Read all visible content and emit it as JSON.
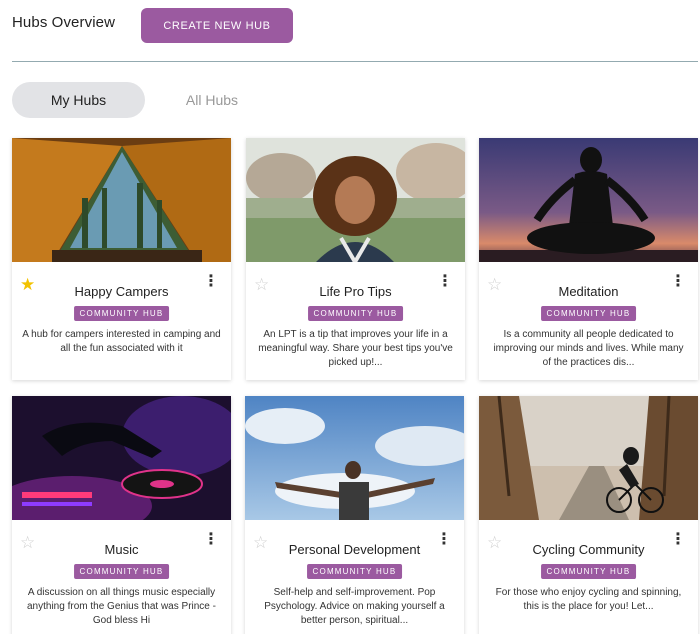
{
  "header": {
    "title": "Hubs Overview",
    "create_button": "CREATE NEW HUB"
  },
  "tabs": [
    {
      "label": "My Hubs",
      "active": true
    },
    {
      "label": "All Hubs",
      "active": false
    }
  ],
  "colors": {
    "accent": "#9b5aa0",
    "tab_active_bg": "#e2e3e6",
    "star_favorite": "#f2c200"
  },
  "hubs": [
    {
      "title": "Happy Campers",
      "badge": "COMMUNITY HUB",
      "description": "A hub for campers interested in camping and all the fun associated with it",
      "favorite": true,
      "image": "tent-camping"
    },
    {
      "title": "Life Pro Tips",
      "badge": "COMMUNITY HUB",
      "description": "An LPT is a tip that improves your life in a meaningful way. Share your best tips you've picked up!...",
      "favorite": false,
      "image": "smiling-woman"
    },
    {
      "title": "Meditation",
      "badge": "COMMUNITY HUB",
      "description": "Is a community all people dedicated to improving our minds and lives. While many of the practices dis...",
      "favorite": false,
      "image": "meditation-silhouette"
    },
    {
      "title": "Music",
      "badge": "COMMUNITY HUB",
      "description": "A discussion on all things music especially anything from the Genius that was Prince - God bless Hi",
      "favorite": false,
      "image": "dj-turntable"
    },
    {
      "title": "Personal Development",
      "badge": "COMMUNITY HUB",
      "description": "Self-help and self-improvement. Pop Psychology. Advice on making yourself a better person, spiritual...",
      "favorite": false,
      "image": "arms-open-sky"
    },
    {
      "title": "Cycling Community",
      "badge": "COMMUNITY HUB",
      "description": "For those who enjoy cycling and spinning, this is the place for you! Let...",
      "favorite": false,
      "image": "cyclist-road"
    }
  ]
}
